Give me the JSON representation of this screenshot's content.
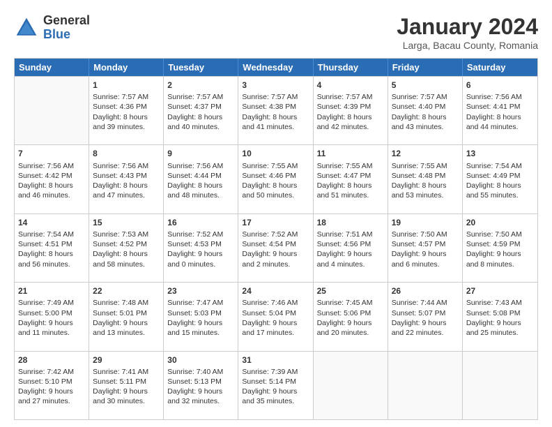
{
  "logo": {
    "general": "General",
    "blue": "Blue"
  },
  "title": "January 2024",
  "location": "Larga, Bacau County, Romania",
  "days": [
    "Sunday",
    "Monday",
    "Tuesday",
    "Wednesday",
    "Thursday",
    "Friday",
    "Saturday"
  ],
  "weeks": [
    [
      {
        "day": "",
        "sunrise": "",
        "sunset": "",
        "daylight": "",
        "empty": true
      },
      {
        "day": "1",
        "sunrise": "Sunrise: 7:57 AM",
        "sunset": "Sunset: 4:36 PM",
        "daylight": "Daylight: 8 hours and 39 minutes."
      },
      {
        "day": "2",
        "sunrise": "Sunrise: 7:57 AM",
        "sunset": "Sunset: 4:37 PM",
        "daylight": "Daylight: 8 hours and 40 minutes."
      },
      {
        "day": "3",
        "sunrise": "Sunrise: 7:57 AM",
        "sunset": "Sunset: 4:38 PM",
        "daylight": "Daylight: 8 hours and 41 minutes."
      },
      {
        "day": "4",
        "sunrise": "Sunrise: 7:57 AM",
        "sunset": "Sunset: 4:39 PM",
        "daylight": "Daylight: 8 hours and 42 minutes."
      },
      {
        "day": "5",
        "sunrise": "Sunrise: 7:57 AM",
        "sunset": "Sunset: 4:40 PM",
        "daylight": "Daylight: 8 hours and 43 minutes."
      },
      {
        "day": "6",
        "sunrise": "Sunrise: 7:56 AM",
        "sunset": "Sunset: 4:41 PM",
        "daylight": "Daylight: 8 hours and 44 minutes."
      }
    ],
    [
      {
        "day": "7",
        "sunrise": "Sunrise: 7:56 AM",
        "sunset": "Sunset: 4:42 PM",
        "daylight": "Daylight: 8 hours and 46 minutes."
      },
      {
        "day": "8",
        "sunrise": "Sunrise: 7:56 AM",
        "sunset": "Sunset: 4:43 PM",
        "daylight": "Daylight: 8 hours and 47 minutes."
      },
      {
        "day": "9",
        "sunrise": "Sunrise: 7:56 AM",
        "sunset": "Sunset: 4:44 PM",
        "daylight": "Daylight: 8 hours and 48 minutes."
      },
      {
        "day": "10",
        "sunrise": "Sunrise: 7:55 AM",
        "sunset": "Sunset: 4:46 PM",
        "daylight": "Daylight: 8 hours and 50 minutes."
      },
      {
        "day": "11",
        "sunrise": "Sunrise: 7:55 AM",
        "sunset": "Sunset: 4:47 PM",
        "daylight": "Daylight: 8 hours and 51 minutes."
      },
      {
        "day": "12",
        "sunrise": "Sunrise: 7:55 AM",
        "sunset": "Sunset: 4:48 PM",
        "daylight": "Daylight: 8 hours and 53 minutes."
      },
      {
        "day": "13",
        "sunrise": "Sunrise: 7:54 AM",
        "sunset": "Sunset: 4:49 PM",
        "daylight": "Daylight: 8 hours and 55 minutes."
      }
    ],
    [
      {
        "day": "14",
        "sunrise": "Sunrise: 7:54 AM",
        "sunset": "Sunset: 4:51 PM",
        "daylight": "Daylight: 8 hours and 56 minutes."
      },
      {
        "day": "15",
        "sunrise": "Sunrise: 7:53 AM",
        "sunset": "Sunset: 4:52 PM",
        "daylight": "Daylight: 8 hours and 58 minutes."
      },
      {
        "day": "16",
        "sunrise": "Sunrise: 7:52 AM",
        "sunset": "Sunset: 4:53 PM",
        "daylight": "Daylight: 9 hours and 0 minutes."
      },
      {
        "day": "17",
        "sunrise": "Sunrise: 7:52 AM",
        "sunset": "Sunset: 4:54 PM",
        "daylight": "Daylight: 9 hours and 2 minutes."
      },
      {
        "day": "18",
        "sunrise": "Sunrise: 7:51 AM",
        "sunset": "Sunset: 4:56 PM",
        "daylight": "Daylight: 9 hours and 4 minutes."
      },
      {
        "day": "19",
        "sunrise": "Sunrise: 7:50 AM",
        "sunset": "Sunset: 4:57 PM",
        "daylight": "Daylight: 9 hours and 6 minutes."
      },
      {
        "day": "20",
        "sunrise": "Sunrise: 7:50 AM",
        "sunset": "Sunset: 4:59 PM",
        "daylight": "Daylight: 9 hours and 8 minutes."
      }
    ],
    [
      {
        "day": "21",
        "sunrise": "Sunrise: 7:49 AM",
        "sunset": "Sunset: 5:00 PM",
        "daylight": "Daylight: 9 hours and 11 minutes."
      },
      {
        "day": "22",
        "sunrise": "Sunrise: 7:48 AM",
        "sunset": "Sunset: 5:01 PM",
        "daylight": "Daylight: 9 hours and 13 minutes."
      },
      {
        "day": "23",
        "sunrise": "Sunrise: 7:47 AM",
        "sunset": "Sunset: 5:03 PM",
        "daylight": "Daylight: 9 hours and 15 minutes."
      },
      {
        "day": "24",
        "sunrise": "Sunrise: 7:46 AM",
        "sunset": "Sunset: 5:04 PM",
        "daylight": "Daylight: 9 hours and 17 minutes."
      },
      {
        "day": "25",
        "sunrise": "Sunrise: 7:45 AM",
        "sunset": "Sunset: 5:06 PM",
        "daylight": "Daylight: 9 hours and 20 minutes."
      },
      {
        "day": "26",
        "sunrise": "Sunrise: 7:44 AM",
        "sunset": "Sunset: 5:07 PM",
        "daylight": "Daylight: 9 hours and 22 minutes."
      },
      {
        "day": "27",
        "sunrise": "Sunrise: 7:43 AM",
        "sunset": "Sunset: 5:08 PM",
        "daylight": "Daylight: 9 hours and 25 minutes."
      }
    ],
    [
      {
        "day": "28",
        "sunrise": "Sunrise: 7:42 AM",
        "sunset": "Sunset: 5:10 PM",
        "daylight": "Daylight: 9 hours and 27 minutes."
      },
      {
        "day": "29",
        "sunrise": "Sunrise: 7:41 AM",
        "sunset": "Sunset: 5:11 PM",
        "daylight": "Daylight: 9 hours and 30 minutes."
      },
      {
        "day": "30",
        "sunrise": "Sunrise: 7:40 AM",
        "sunset": "Sunset: 5:13 PM",
        "daylight": "Daylight: 9 hours and 32 minutes."
      },
      {
        "day": "31",
        "sunrise": "Sunrise: 7:39 AM",
        "sunset": "Sunset: 5:14 PM",
        "daylight": "Daylight: 9 hours and 35 minutes."
      },
      {
        "day": "",
        "sunrise": "",
        "sunset": "",
        "daylight": "",
        "empty": true
      },
      {
        "day": "",
        "sunrise": "",
        "sunset": "",
        "daylight": "",
        "empty": true
      },
      {
        "day": "",
        "sunrise": "",
        "sunset": "",
        "daylight": "",
        "empty": true
      }
    ]
  ]
}
